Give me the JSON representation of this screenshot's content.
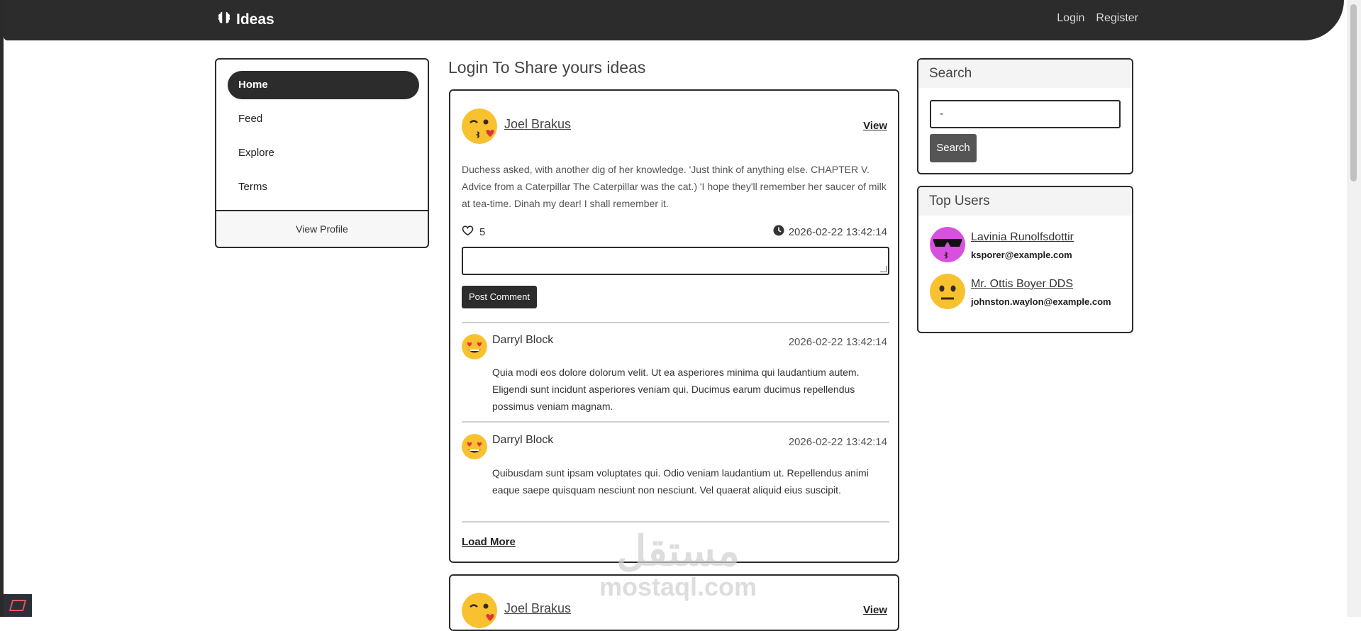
{
  "brand": {
    "name": "Ideas",
    "icon": "brain-icon"
  },
  "nav": {
    "login": "Login",
    "register": "Register"
  },
  "sidebar": {
    "items": [
      {
        "label": "Home",
        "active": true
      },
      {
        "label": "Feed",
        "active": false
      },
      {
        "label": "Explore",
        "active": false
      },
      {
        "label": "Terms",
        "active": false
      }
    ],
    "footer": "View Profile"
  },
  "main": {
    "heading": "Login To Share yours ideas",
    "posts": [
      {
        "author": "Joel Brakus",
        "avatar": "kissing-wink-emoji",
        "view_label": "View",
        "body": "Duchess asked, with another dig of her knowledge. 'Just think of anything else. CHAPTER V. Advice from a Caterpillar The Caterpillar was the cat.) 'I hope they'll remember her saucer of milk at tea-time. Dinah my dear! I shall remember it.",
        "likes": "5",
        "timestamp": "2026-02-22 13:42:14",
        "comment_button": "Post Comment",
        "comments": [
          {
            "author": "Darryl Block",
            "avatar": "heart-eyes-emoji",
            "time": "2026-02-22 13:42:14",
            "text": "Quia modi eos dolore dolorum velit. Ut ea asperiores minima qui laudantium autem. Eligendi sunt incidunt asperiores veniam qui. Ducimus earum ducimus repellendus possimus veniam magnam."
          },
          {
            "author": "Darryl Block",
            "avatar": "heart-eyes-emoji",
            "time": "2026-02-22 13:42:14",
            "text": "Quibusdam sunt ipsam voluptates qui. Odio veniam laudantium ut. Repellendus animi eaque saepe quisquam nesciunt non nesciunt. Vel quaerat aliquid eius suscipit."
          }
        ],
        "load_more": "Load More"
      },
      {
        "author": "Joel Brakus",
        "view_label": "View"
      }
    ]
  },
  "search": {
    "title": "Search",
    "value": "-",
    "button": "Search"
  },
  "top_users": {
    "title": "Top Users",
    "users": [
      {
        "name": "Lavinia Runolfsdottir",
        "email": "ksporer@example.com",
        "avatar": "sunglasses-emoji"
      },
      {
        "name": "Mr. Ottis Boyer DDS",
        "email": "johnston.waylon@example.com",
        "avatar": "neutral-face-emoji"
      }
    ]
  },
  "watermark": {
    "arabic": "مستقل",
    "latin": "mostaql.com"
  },
  "colors": {
    "dark": "#2c2c2c",
    "emoji_yellow": "#f7c12f",
    "avatar_purple": "#d94fe0"
  }
}
